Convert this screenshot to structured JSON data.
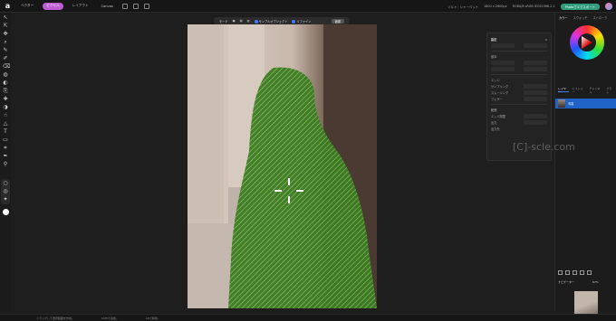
{
  "app": {
    "logo": "a",
    "nav": [
      {
        "label": "ベクター",
        "active": false
      },
      {
        "label": "ピクセル",
        "active": true
      },
      {
        "label": "レイアウト",
        "active": false
      },
      {
        "label": "Canvas",
        "active": false
      }
    ],
    "doc_info": "ソルト・シャーベット",
    "doc_size": "1800 x 2600px",
    "zoom_info": "RGBA/8 sRGB IEC61966-2.1",
    "share_button": "Photoでエクスポート"
  },
  "floating_toolbar": {
    "mode_label": "モード",
    "option1": "サンプルオブジェクト",
    "option2": "リファイン",
    "apply_button": "適用"
  },
  "mask_panel": {
    "title": "設定",
    "section_basic": "基本",
    "section_refine": "エッジ",
    "section_detect": "範囲",
    "section_output": "出力",
    "field1": "サンプリング",
    "field2": "スムージング",
    "field3": "フェザー",
    "field4": "エッジ調整",
    "footer": "出力先"
  },
  "right_panel": {
    "tabs": [
      "カラー",
      "スウォッチ",
      "ストローク"
    ],
    "layer_tabs": [
      "レイヤー",
      "ヒストリー",
      "チャンネル",
      "ブラシ"
    ],
    "layer_name": "写真",
    "navigator": "ナビゲーター",
    "zoom": "67%"
  },
  "status": {
    "text1": "ドラッグして選択範囲を作成。",
    "text2": "Shiftで追加。",
    "text3": "Altで削除。"
  },
  "watermark": "[C]-scle.com",
  "colors": {
    "accent_pink": "#c05bd6",
    "selection_green": "#4f9c2e",
    "layer_blue": "#1f63c6",
    "export_green": "#2f9d7a"
  }
}
